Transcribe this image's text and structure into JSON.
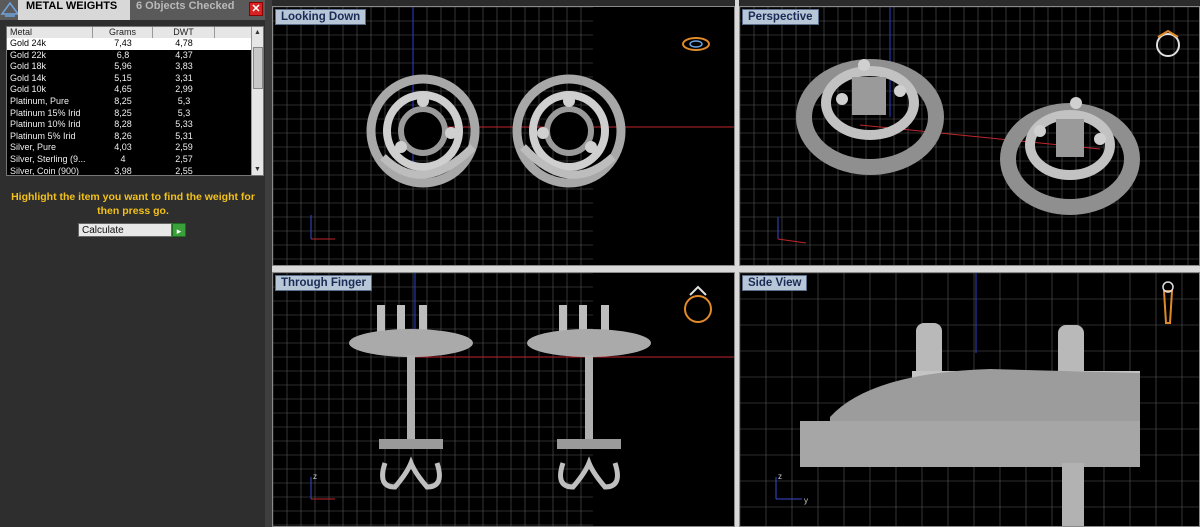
{
  "panel": {
    "tab_active": "METAL WEIGHTS",
    "tab_inactive": "6 Objects Checked",
    "close_label": "✕",
    "headers": [
      "Metal",
      "Grams",
      "DWT"
    ],
    "rows": [
      {
        "metal": "Gold 24k",
        "grams": "7,43",
        "dwt": "4,78"
      },
      {
        "metal": "Gold 22k",
        "grams": "6,8",
        "dwt": "4,37"
      },
      {
        "metal": "Gold 18k",
        "grams": "5,96",
        "dwt": "3,83"
      },
      {
        "metal": "Gold 14k",
        "grams": "5,15",
        "dwt": "3,31"
      },
      {
        "metal": "Gold 10k",
        "grams": "4,65",
        "dwt": "2,99"
      },
      {
        "metal": "Platinum, Pure",
        "grams": "8,25",
        "dwt": "5,3"
      },
      {
        "metal": "Platinum 15% Irid",
        "grams": "8,25",
        "dwt": "5,3"
      },
      {
        "metal": "Platinum 10% Irid",
        "grams": "8,28",
        "dwt": "5,33"
      },
      {
        "metal": "Platinum 5% Irid",
        "grams": "8,26",
        "dwt": "5,31"
      },
      {
        "metal": "Silver, Pure",
        "grams": "4,03",
        "dwt": "2,59"
      },
      {
        "metal": "Silver, Sterling (9...",
        "grams": "4",
        "dwt": "2,57"
      },
      {
        "metal": "Silver, Coin (900)",
        "grams": "3,98",
        "dwt": "2,55"
      }
    ],
    "instruction": "Highlight the item you want to find the weight for then press go.",
    "calc_value": "Calculate",
    "go_label": "▸"
  },
  "viewports": {
    "top_left": "Looking Down",
    "top_right": "Perspective",
    "bottom_left": "Through Finger",
    "bottom_right": "Side View"
  },
  "axes": {
    "x": "x",
    "y": "y",
    "z": "z"
  },
  "colors": {
    "grid": "#5a5a5a",
    "axis_red": "#c0262c",
    "axis_blue": "#2a3fd0",
    "metal": "#b5b5b5",
    "gizmo": "#e08a2a",
    "instruction": "#f3c11b"
  }
}
